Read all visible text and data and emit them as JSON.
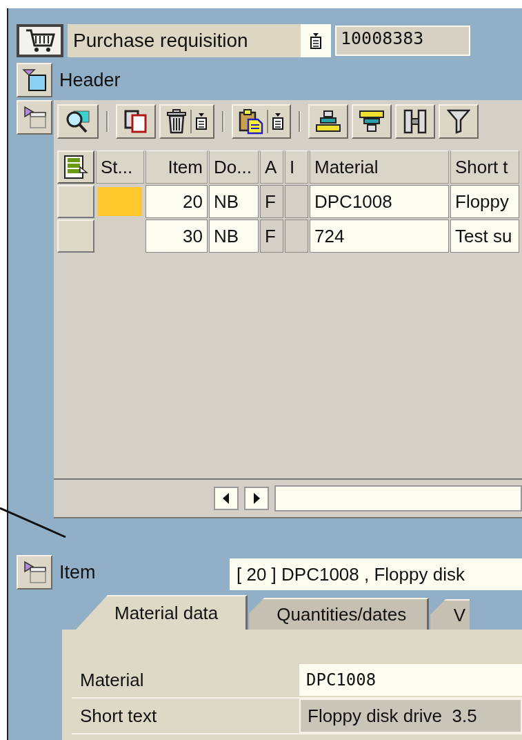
{
  "document_bar": {
    "document_type": "Purchase requisition",
    "document_number": "10008383"
  },
  "header_section": {
    "label": "Header"
  },
  "items_table": {
    "columns": [
      "St...",
      "Item",
      "Do...",
      "A",
      "I",
      "Material",
      "Short t"
    ],
    "rows": [
      {
        "selected": false,
        "color": "#ffc92e",
        "cells": [
          "",
          "20",
          "NB",
          "F",
          "",
          "DPC1008",
          "Floppy"
        ]
      },
      {
        "selected": false,
        "cells": [
          "",
          "30",
          "NB",
          "F",
          "",
          "724",
          "Test su"
        ]
      }
    ]
  },
  "item_section": {
    "label": "Item",
    "value": "[ 20 ] DPC1008 , Floppy disk"
  },
  "tabs": [
    {
      "label": "Material data",
      "selected": true
    },
    {
      "label": "Quantities/dates",
      "selected": false
    },
    {
      "label": "V",
      "selected": false
    }
  ],
  "fields": [
    {
      "label": "Material",
      "value": "DPC1008",
      "editable": true
    },
    {
      "label": "Short text",
      "value": "Floppy disk drive  3.5",
      "editable": false
    }
  ]
}
